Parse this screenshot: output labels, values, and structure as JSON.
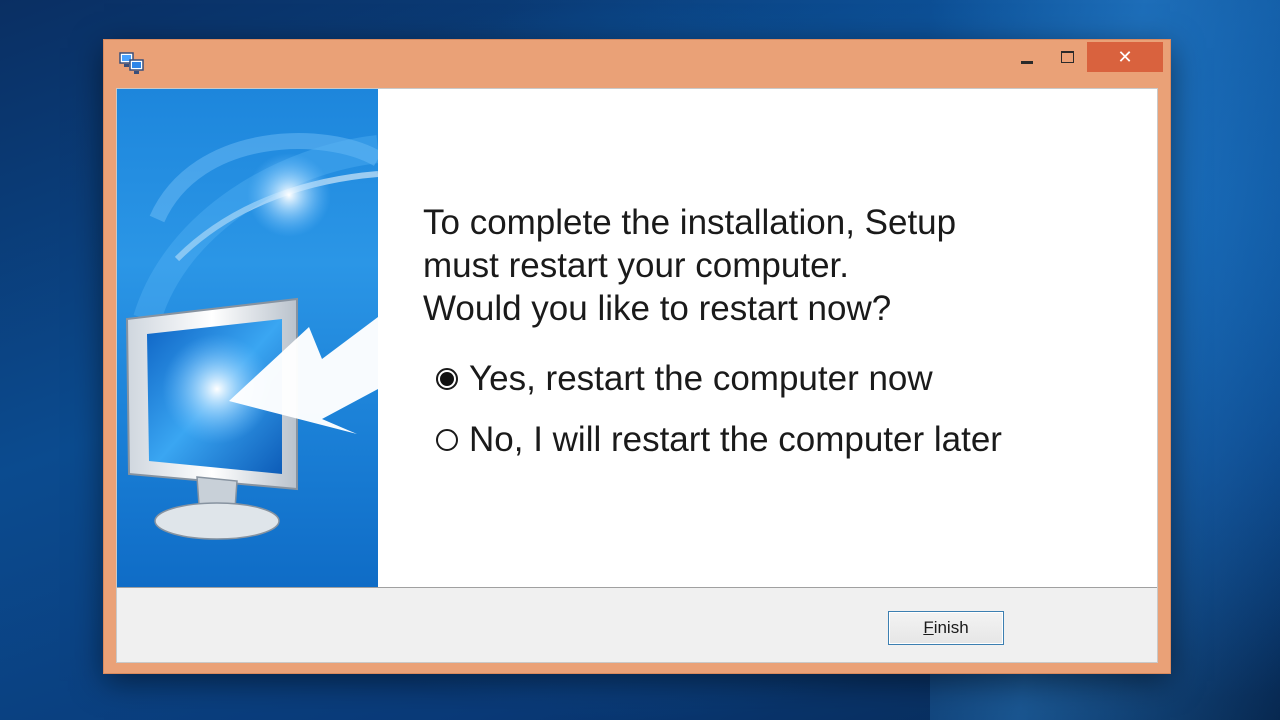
{
  "window": {
    "title_icon": "setup-computers-icon",
    "controls": {
      "minimize_icon": "minimize-icon",
      "maximize_icon": "maximize-icon",
      "close_glyph": "✕"
    },
    "frame_color": "#eaa177",
    "close_color": "#d9623e"
  },
  "banner": {
    "illustration": "monitor-with-arrow-illustration",
    "color": "#2b96e6"
  },
  "message": {
    "line1": "To complete the installation, Setup",
    "line2": "must restart your computer.",
    "line3": "Would you like to restart now?"
  },
  "options": [
    {
      "label": "Yes, restart the computer now",
      "selected": true
    },
    {
      "label": "No, I will restart the computer later",
      "selected": false
    }
  ],
  "buttons": {
    "finish_mnemonic": "F",
    "finish_rest": "inish"
  }
}
